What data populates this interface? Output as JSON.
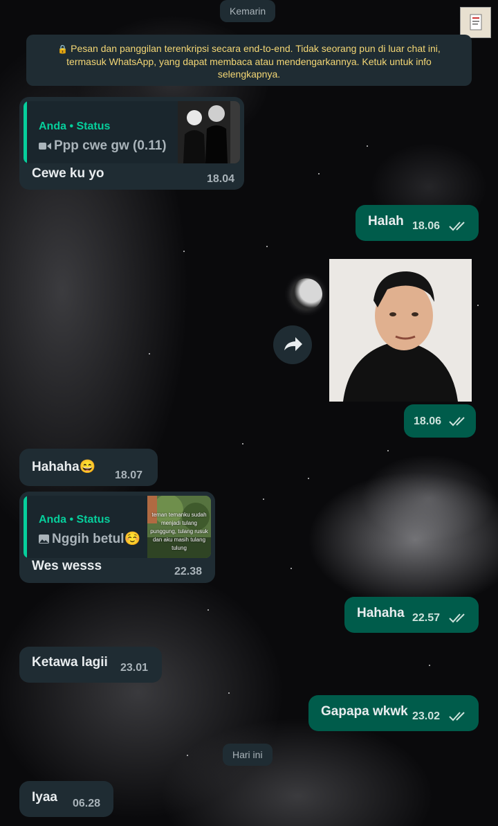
{
  "theme": {
    "incoming_bubble": "#1f2c33",
    "outgoing_bubble": "#005c4b",
    "accent": "#06cf9c",
    "read_ticks": "#53bdeb",
    "encryption_text": "#f4d775"
  },
  "date_dividers": {
    "yesterday": "Kemarin",
    "today": "Hari ini"
  },
  "encryption_notice": {
    "icon": "lock-icon",
    "text": "Pesan dan panggilan terenkripsi secara end-to-end. Tidak seorang pun di luar chat ini, termasuk WhatsApp, yang dapat membaca atau mendengarkannya. Ketuk untuk info selengkapnya."
  },
  "messages": [
    {
      "direction": "in",
      "quote": {
        "author": "Anda • Status",
        "icon": "video-icon",
        "text": "Ppp cwe gw (0.11)"
      },
      "text": "Cewe ku yo",
      "time": "18.04"
    },
    {
      "direction": "out",
      "text": "Halah",
      "time": "18.06",
      "status": "read"
    },
    {
      "direction": "out",
      "type": "image",
      "icon": "forward-icon",
      "time": "18.06",
      "status": "read"
    },
    {
      "direction": "in",
      "text": "Hahaha😄",
      "time": "18.07"
    },
    {
      "direction": "in",
      "quote": {
        "author": "Anda • Status",
        "icon": "image-icon",
        "text": "Nggih betul☺️",
        "thumb_text": "teman temanku sudah menjadi tulang punggung, tulang rusuk dan aku masih tulang tulung"
      },
      "text": "Wes wesss",
      "time": "22.38"
    },
    {
      "direction": "out",
      "text": "Hahaha",
      "time": "22.57",
      "status": "read"
    },
    {
      "direction": "in",
      "text": "Ketawa lagii",
      "time": "23.01"
    },
    {
      "direction": "out",
      "text": "Gapapa wkwk",
      "time": "23.02",
      "status": "read"
    },
    {
      "direction": "in",
      "text": "Iyaa",
      "time": "06.28"
    }
  ]
}
